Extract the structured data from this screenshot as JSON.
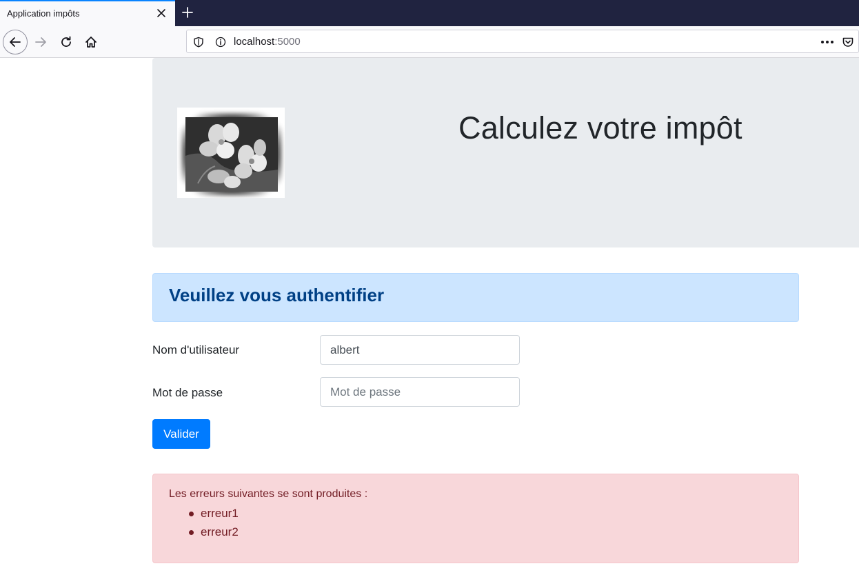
{
  "browser": {
    "tab_title": "Application impôts",
    "url_host": "localhost",
    "url_port": ":5000",
    "accent_color": "#0a84ff"
  },
  "header": {
    "logo_icon": "flower-photo",
    "title": "Calculez votre impôt"
  },
  "login": {
    "banner": "Veuillez vous authentifier",
    "username_label": "Nom d'utilisateur",
    "username_value": "albert",
    "password_label": "Mot de passe",
    "password_placeholder": "Mot de passe",
    "submit_label": "Valider"
  },
  "errors": {
    "heading": "Les erreurs suivantes se sont produites :",
    "items": [
      "erreur1",
      "erreur2"
    ]
  },
  "colors": {
    "primary_button": "#007bff",
    "info_alert_bg": "#cce5ff",
    "danger_alert_bg": "#f8d7da",
    "jumbotron_bg": "#e9ecef"
  }
}
